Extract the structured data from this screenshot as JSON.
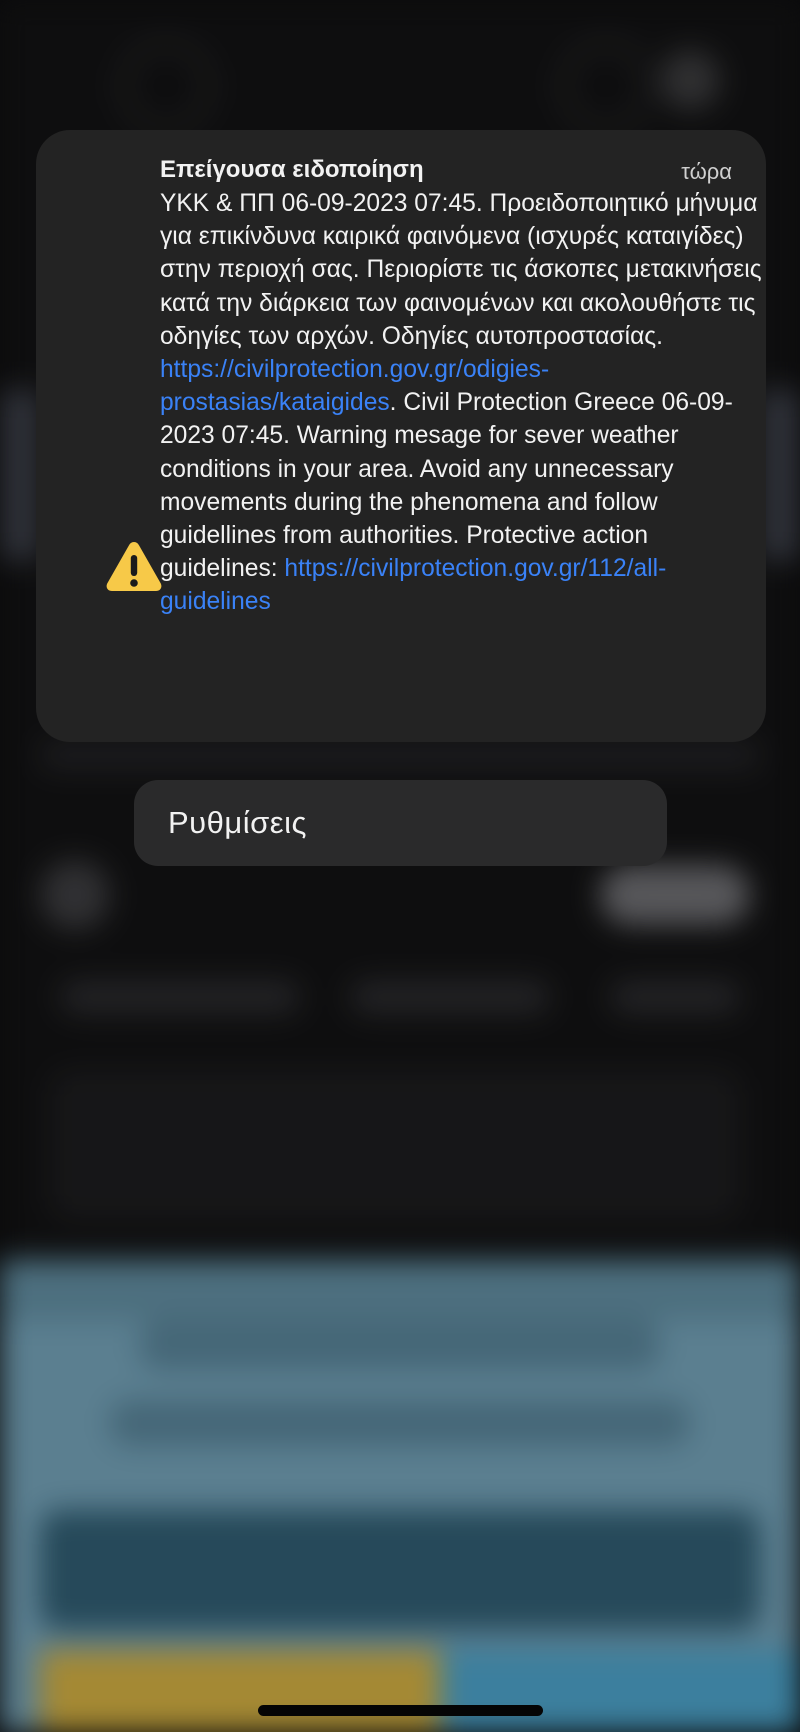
{
  "notification": {
    "title": "Επείγουσα ειδοποίηση",
    "time": "τώρα",
    "icon": "warning-triangle-icon",
    "body": {
      "text_part1": "ΥΚΚ & ΠΠ 06-09-2023 07:45. Προειδοποιητικό μήνυμα για επικίνδυνα καιρικά φαινόμενα (ισχυρές καταιγίδες) στην περιοχή σας. Περιορίστε τις άσκοπες μετακινήσεις κατά την διάρκεια των φαινομένων και ακολουθήστε τις οδηγίες των αρχών. Οδηγίες αυτοπροστασίας. ",
      "link1": "https://civilprotection.gov.gr/odigies-prostasias/kataigides",
      "text_part2": ". Civil Protection Greece 06-09-2023 07:45. Warning mesage for sever weather conditions in your area. Avoid any unnecessary movements during the phenomena and follow guidellines from authorities. Protective action guidelines: ",
      "link2": "https://civilprotection.gov.gr/112/all-guidelines"
    }
  },
  "actions": {
    "settings_label": "Ρυθμίσεις"
  },
  "colors": {
    "link": "#3a82f7",
    "warning_yellow": "#f7c948",
    "card_background": "#232323"
  }
}
